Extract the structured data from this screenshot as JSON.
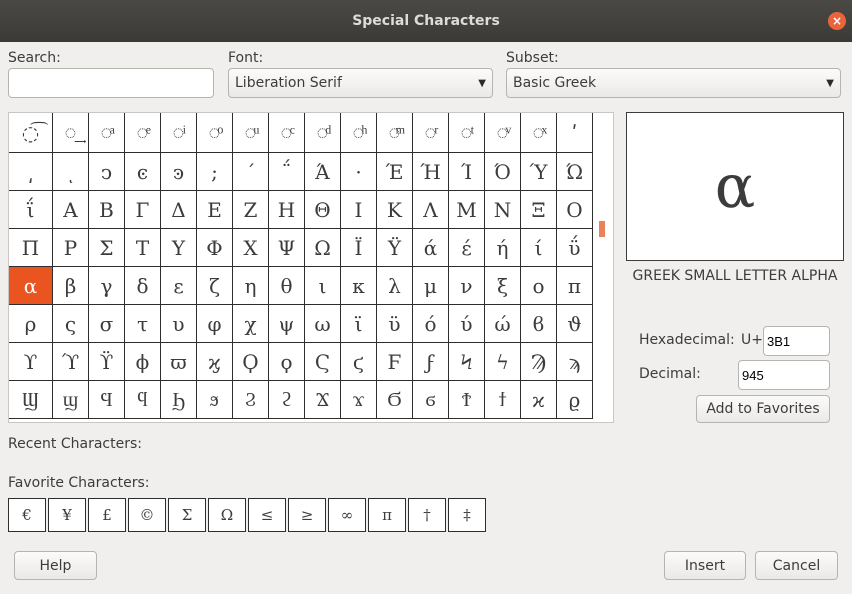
{
  "window": {
    "title": "Special Characters",
    "close_label": "×"
  },
  "search": {
    "label": "Search:",
    "value": ""
  },
  "font": {
    "label": "Font:",
    "value": "Liberation Serif"
  },
  "subset": {
    "label": "Subset:",
    "value": "Basic Greek"
  },
  "grid": {
    "rows": [
      [
        "◌͡",
        "◌͢",
        "◌ͣ",
        "◌ͤ",
        "◌ͥ",
        "◌ͦ",
        "◌ͧ",
        "◌ͨ",
        "◌ͩ",
        "◌ͪ",
        "◌ͫ",
        "◌ͬ",
        "◌ͭ",
        "◌ͮ",
        "◌ͯ",
        "ʹ"
      ],
      [
        "͵",
        "ͺ",
        "ͻ",
        "ͼ",
        "ͽ",
        ";",
        "΄",
        "΅",
        "Ά",
        "·",
        "Έ",
        "Ή",
        "Ί",
        "Ό",
        "Ύ",
        "Ώ"
      ],
      [
        "ΐ",
        "Α",
        "Β",
        "Γ",
        "Δ",
        "Ε",
        "Ζ",
        "Η",
        "Θ",
        "Ι",
        "Κ",
        "Λ",
        "Μ",
        "Ν",
        "Ξ",
        "Ο"
      ],
      [
        "Π",
        "Ρ",
        "Σ",
        "Τ",
        "Υ",
        "Φ",
        "Χ",
        "Ψ",
        "Ω",
        "Ϊ",
        "Ϋ",
        "ά",
        "έ",
        "ή",
        "ί",
        "ΰ"
      ],
      [
        "α",
        "β",
        "γ",
        "δ",
        "ε",
        "ζ",
        "η",
        "θ",
        "ι",
        "κ",
        "λ",
        "μ",
        "ν",
        "ξ",
        "ο",
        "π"
      ],
      [
        "ρ",
        "ς",
        "σ",
        "τ",
        "υ",
        "φ",
        "χ",
        "ψ",
        "ω",
        "ϊ",
        "ϋ",
        "ό",
        "ύ",
        "ώ",
        "ϐ",
        "ϑ"
      ],
      [
        "ϒ",
        "ϓ",
        "ϔ",
        "ϕ",
        "ϖ",
        "ϗ",
        "Ϙ",
        "ϙ",
        "Ϛ",
        "ϛ",
        "Ϝ",
        "ϝ",
        "Ϟ",
        "ϟ",
        "Ϡ",
        "ϡ"
      ],
      [
        "Ϣ",
        "ϣ",
        "Ϥ",
        "ϥ",
        "Ϧ",
        "ϧ",
        "Ϩ",
        "ϩ",
        "Ϫ",
        "ϫ",
        "Ϭ",
        "ϭ",
        "Ϯ",
        "ϯ",
        "ϰ",
        "ϱ"
      ]
    ],
    "selected": "α"
  },
  "preview": {
    "char": "α",
    "name": "GREEK SMALL LETTER ALPHA"
  },
  "hex": {
    "label": "Hexadecimal:",
    "prefix": "U+",
    "value": "3B1"
  },
  "decimal": {
    "label": "Decimal:",
    "value": "945"
  },
  "add_favorites": "Add to Favorites",
  "recent": {
    "label": "Recent Characters:"
  },
  "favorites": {
    "label": "Favorite Characters:",
    "items": [
      "€",
      "¥",
      "£",
      "©",
      "Σ",
      "Ω",
      "≤",
      "≥",
      "∞",
      "π",
      "†",
      "‡"
    ]
  },
  "buttons": {
    "help": "Help",
    "insert": "Insert",
    "cancel": "Cancel"
  },
  "colors": {
    "accent": "#e95420",
    "titlebar": "#3b3a36"
  }
}
